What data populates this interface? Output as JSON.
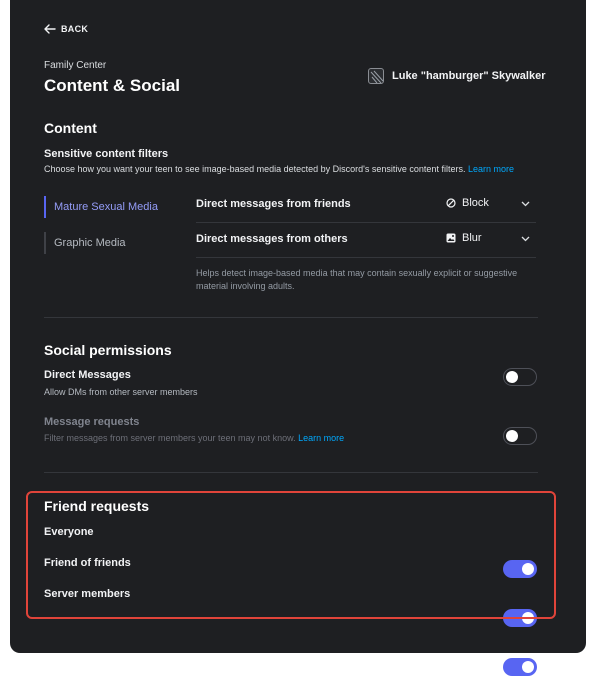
{
  "header": {
    "back_label": "BACK",
    "breadcrumb": "Family Center",
    "title": "Content & Social",
    "user_name": "Luke \"hamburger\" Skywalker"
  },
  "content": {
    "heading": "Content",
    "filters_title": "Sensitive content filters",
    "filters_desc": "Choose how you want your teen to see image-based media detected by Discord's sensitive content filters.",
    "filters_link": "Learn more",
    "categories": [
      {
        "label": "Mature Sexual Media",
        "active": true
      },
      {
        "label": "Graphic Media",
        "active": false
      }
    ],
    "rows": [
      {
        "label": "Direct messages from friends",
        "value": "Block",
        "icon": "block-icon"
      },
      {
        "label": "Direct messages from others",
        "value": "Blur",
        "icon": "image-icon"
      }
    ],
    "helper": "Helps detect image-based media that may contain sexually explicit or suggestive material involving adults."
  },
  "social": {
    "heading": "Social permissions",
    "items": [
      {
        "label": "Direct Messages",
        "desc": "Allow DMs from other server members",
        "enabled": false
      },
      {
        "label": "Message requests",
        "desc": "Filter messages from server members your teen may not know.",
        "link": "Learn more",
        "enabled": false
      }
    ]
  },
  "friend_requests": {
    "heading": "Friend requests",
    "items": [
      {
        "label": "Everyone",
        "enabled": true
      },
      {
        "label": "Friend of friends",
        "enabled": true
      },
      {
        "label": "Server members",
        "enabled": true
      }
    ]
  },
  "colors": {
    "background": "#1e1f22",
    "accent": "#5865f2",
    "link": "#00a8fc",
    "highlight": "#e0443a"
  }
}
